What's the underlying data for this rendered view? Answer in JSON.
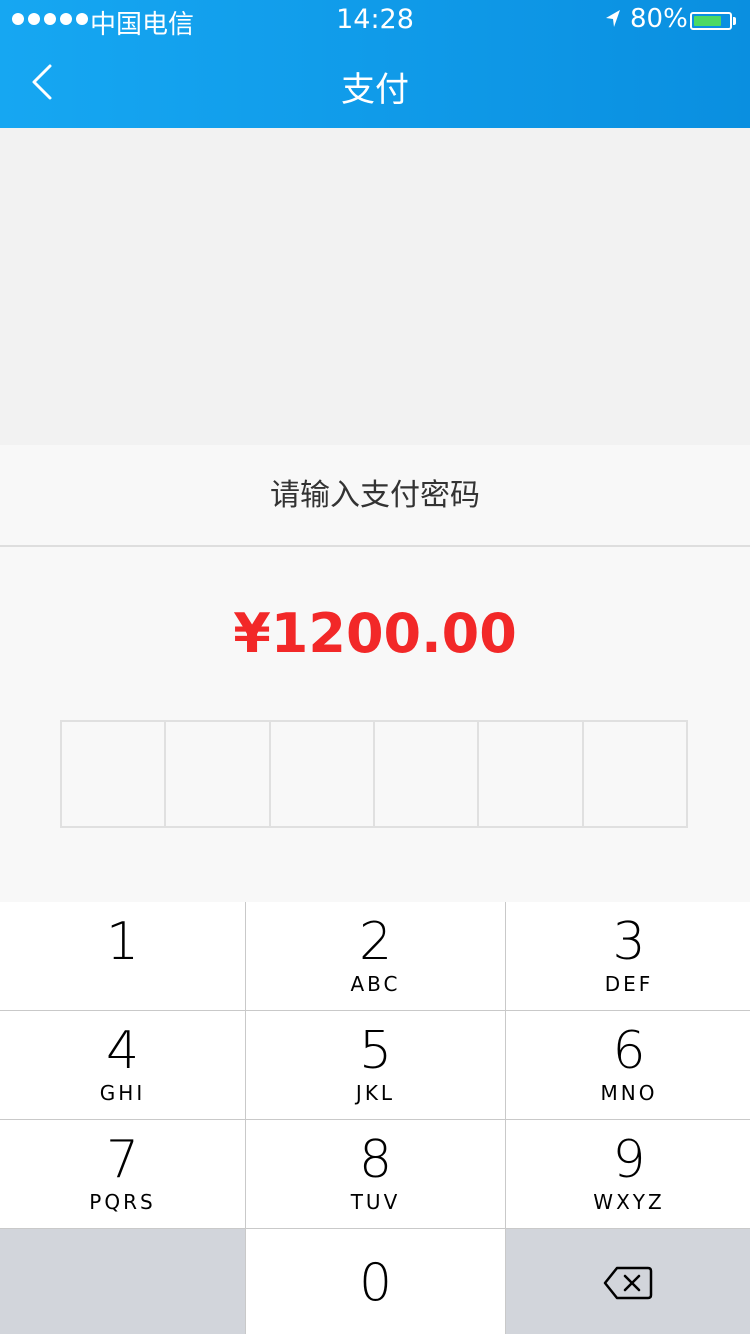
{
  "status_bar": {
    "carrier": "中国电信",
    "time": "14:28",
    "battery_percent": "80%",
    "battery_level": 0.8,
    "battery_color": "#4cd964"
  },
  "nav": {
    "title": "支付",
    "back_icon": "chevron-left-icon"
  },
  "payment_sheet": {
    "title": "请输入支付密码",
    "amount": "¥1200.00",
    "amount_color": "#f22828",
    "password_length": 6
  },
  "keypad": {
    "keys": [
      {
        "num": "1",
        "letters": ""
      },
      {
        "num": "2",
        "letters": "ABC"
      },
      {
        "num": "3",
        "letters": "DEF"
      },
      {
        "num": "4",
        "letters": "GHI"
      },
      {
        "num": "5",
        "letters": "JKL"
      },
      {
        "num": "6",
        "letters": "MNO"
      },
      {
        "num": "7",
        "letters": "PQRS"
      },
      {
        "num": "8",
        "letters": "TUV"
      },
      {
        "num": "9",
        "letters": "WXYZ"
      },
      {
        "num": "0",
        "letters": ""
      }
    ],
    "delete_icon": "backspace-icon"
  }
}
